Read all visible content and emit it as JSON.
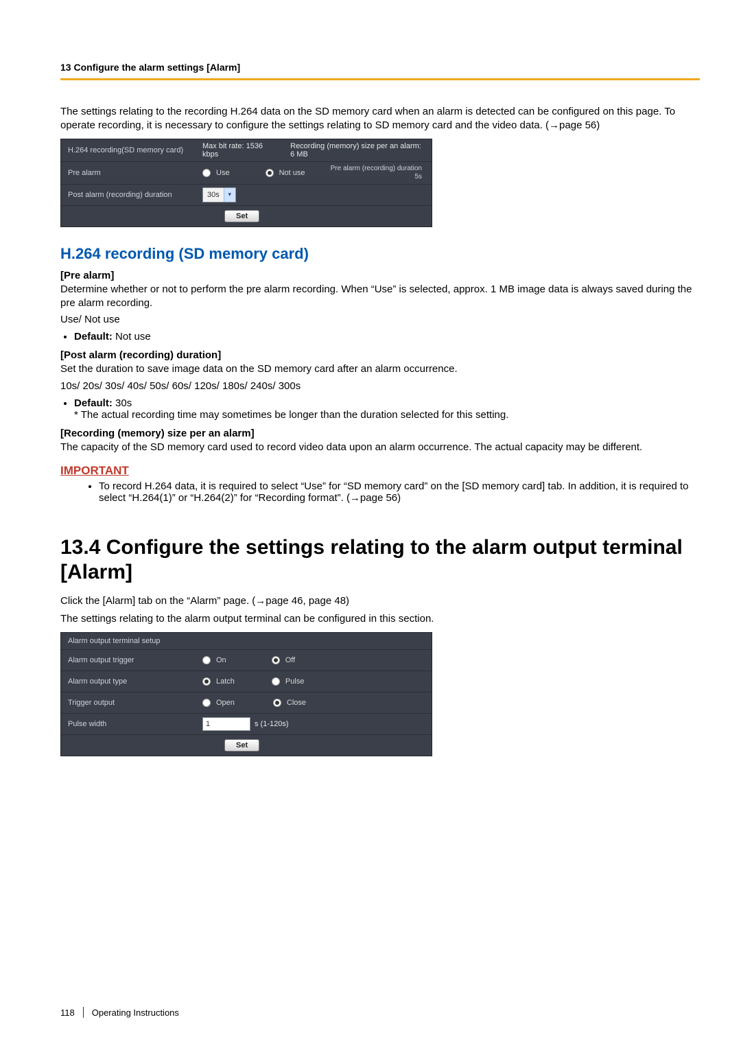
{
  "header": {
    "running": "13 Configure the alarm settings [Alarm]"
  },
  "intro": {
    "para": "The settings relating to the recording H.264 data on the SD memory card when an alarm is detected can be configured on this page. To operate recording, it is necessary to configure the settings relating to SD memory card and the video data. (→page 56)"
  },
  "panel1": {
    "title": "H.264 recording(SD memory card)",
    "bitrate_label": "Max bit rate: 1536 kbps",
    "memsize_label": "Recording (memory) size per an alarm: 6 MB",
    "rows": {
      "pre_alarm": {
        "label": "Pre alarm",
        "opt_use": "Use",
        "opt_notuse": "Not use",
        "info_line1": "Pre alarm (recording) duration",
        "info_line2": "5s"
      },
      "post_duration": {
        "label": "Post alarm (recording) duration",
        "value": "30s"
      }
    },
    "set_label": "Set"
  },
  "section_h264": {
    "title": "H.264 recording (SD memory card)",
    "pre_alarm": {
      "heading": "[Pre alarm]",
      "desc": "Determine whether or not to perform the pre alarm recording. When “Use” is selected, approx. 1 MB image data is always saved during the pre alarm recording.",
      "options_line": "Use/ Not use",
      "default_label": "Default:",
      "default_value": "Not use"
    },
    "post_alarm": {
      "heading": "[Post alarm (recording) duration]",
      "desc": "Set the duration to save image data on the SD memory card after an alarm occurrence.",
      "options_line": "10s/ 20s/ 30s/ 40s/ 50s/ 60s/ 120s/ 180s/ 240s/ 300s",
      "default_label": "Default:",
      "default_value": "30s",
      "note": "* The actual recording time may sometimes be longer than the duration selected for this setting."
    },
    "mem_size": {
      "heading": "[Recording (memory) size per an alarm]",
      "desc": "The capacity of the SD memory card used to record video data upon an alarm occurrence. The actual capacity may be different."
    },
    "important_label": "IMPORTANT",
    "important_bullet": "To record H.264 data, it is required to select “Use” for “SD memory card” on the [SD memory card] tab. In addition, it is required to select “H.264(1)” or “H.264(2)” for “Recording format”. (→page 56)"
  },
  "section_134": {
    "heading": "13.4  Configure the settings relating to the alarm output terminal [Alarm]",
    "line1": "Click the [Alarm] tab on the “Alarm” page. (→page 46, page 48)",
    "line2": "The settings relating to the alarm output terminal can be configured in this section."
  },
  "panel2": {
    "title": "Alarm output terminal setup",
    "rows": {
      "trigger": {
        "label": "Alarm output trigger",
        "opt1": "On",
        "opt2": "Off"
      },
      "type": {
        "label": "Alarm output type",
        "opt1": "Latch",
        "opt2": "Pulse"
      },
      "togg": {
        "label": "Trigger output",
        "opt1": "Open",
        "opt2": "Close"
      },
      "pulse": {
        "label": "Pulse width",
        "value": "1",
        "unit": "s (1-120s)"
      }
    },
    "set_label": "Set"
  },
  "footer": {
    "page": "118",
    "title": "Operating Instructions"
  }
}
